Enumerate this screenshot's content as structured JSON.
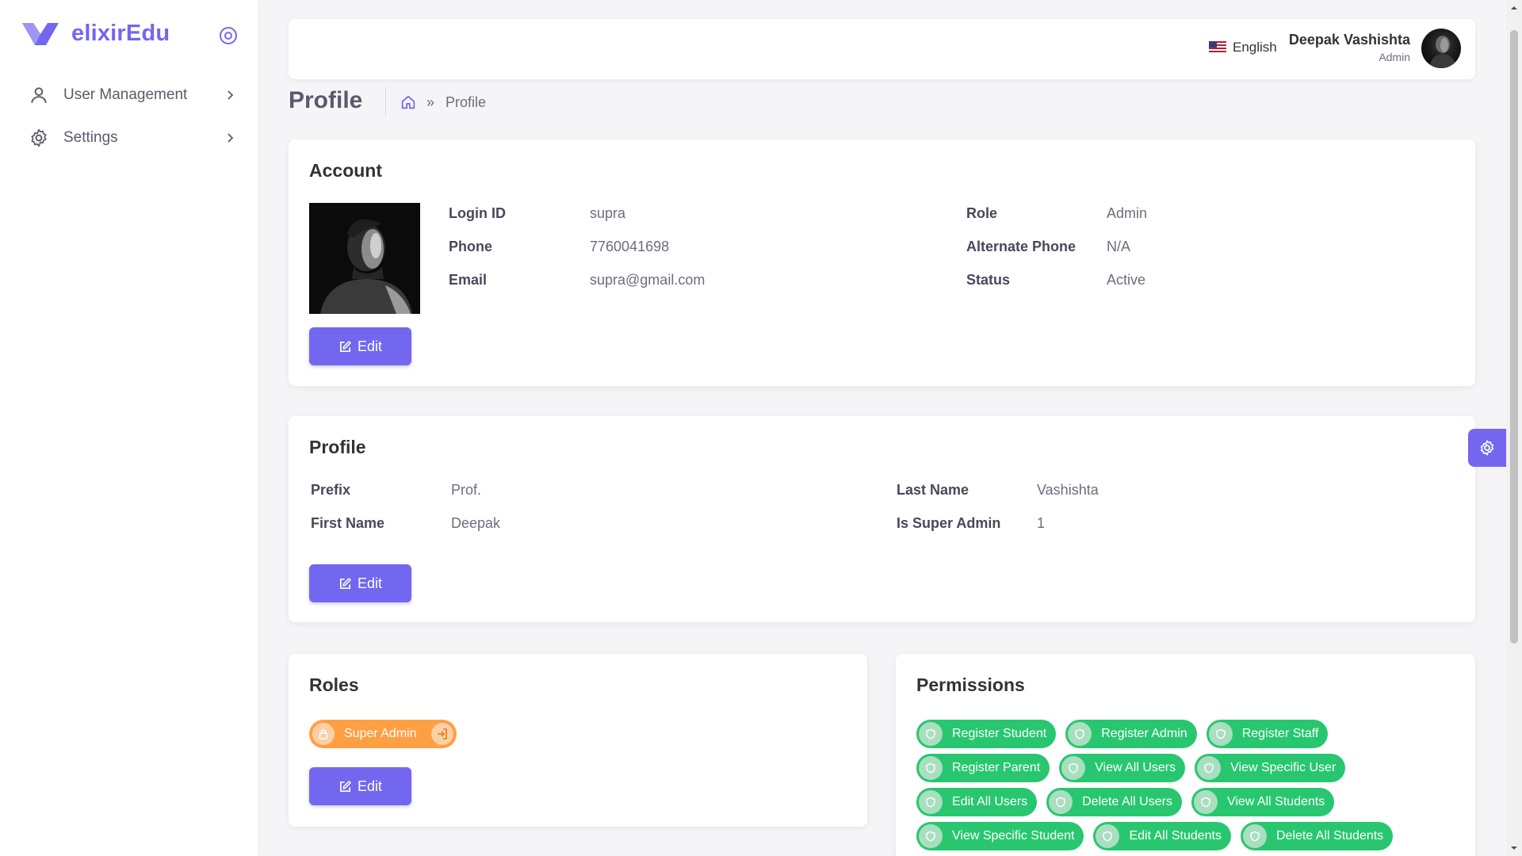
{
  "brand": {
    "name": "elixirEdu",
    "color": "#7367f0"
  },
  "sidebar": {
    "items": [
      {
        "label": "User Management",
        "icon": "user-icon"
      },
      {
        "label": "Settings",
        "icon": "gear-icon"
      }
    ]
  },
  "topbar": {
    "language": "English",
    "user": {
      "name": "Deepak Vashishta",
      "role": "Admin"
    }
  },
  "page": {
    "title": "Profile",
    "breadcrumb": {
      "current": "Profile"
    }
  },
  "account": {
    "title": "Account",
    "fields": {
      "login_id": {
        "label": "Login ID",
        "value": "supra"
      },
      "phone": {
        "label": "Phone",
        "value": "7760041698"
      },
      "email": {
        "label": "Email",
        "value": "supra@gmail.com"
      },
      "role": {
        "label": "Role",
        "value": "Admin"
      },
      "alt_phone": {
        "label": "Alternate Phone",
        "value": "N/A"
      },
      "status": {
        "label": "Status",
        "value": "Active"
      }
    },
    "edit_label": "Edit"
  },
  "profile": {
    "title": "Profile",
    "fields": {
      "prefix": {
        "label": "Prefix",
        "value": "Prof."
      },
      "first_name": {
        "label": "First Name",
        "value": "Deepak"
      },
      "last_name": {
        "label": "Last Name",
        "value": "Vashishta"
      },
      "is_super_admin": {
        "label": "Is Super Admin",
        "value": "1"
      }
    },
    "edit_label": "Edit"
  },
  "roles": {
    "title": "Roles",
    "items": [
      "Super Admin"
    ],
    "edit_label": "Edit"
  },
  "permissions": {
    "title": "Permissions",
    "rows": [
      [
        "Register Student",
        "Register Admin",
        "Register Staff"
      ],
      [
        "Register Parent",
        "View All Users",
        "View Specific User"
      ],
      [
        "Edit All Users",
        "Delete All Users",
        "View All Students"
      ],
      [
        "View Specific Student",
        "Edit All Students",
        "Delete All Students"
      ]
    ]
  },
  "colors": {
    "primary": "#7367f0",
    "role_chip": "#ff9f43",
    "permission_chip": "#28c76f"
  }
}
